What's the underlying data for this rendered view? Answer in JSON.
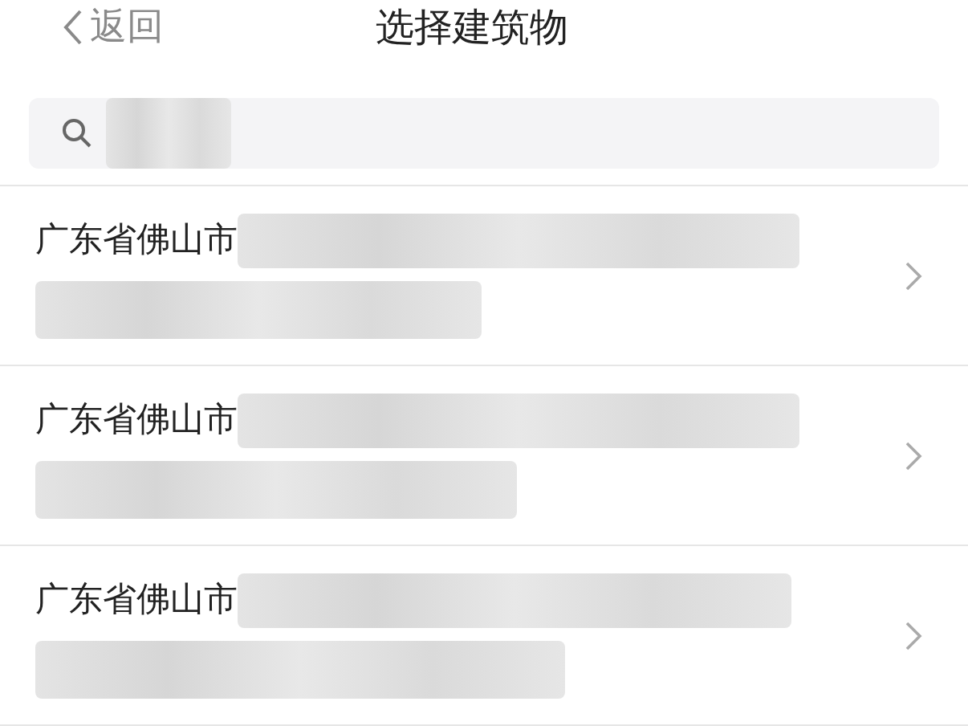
{
  "header": {
    "back_label": "返回",
    "title": "选择建筑物"
  },
  "rows": [
    {
      "text": "广东省佛山市"
    },
    {
      "text": "广东省佛山市"
    },
    {
      "text": "广东省佛山市"
    }
  ]
}
